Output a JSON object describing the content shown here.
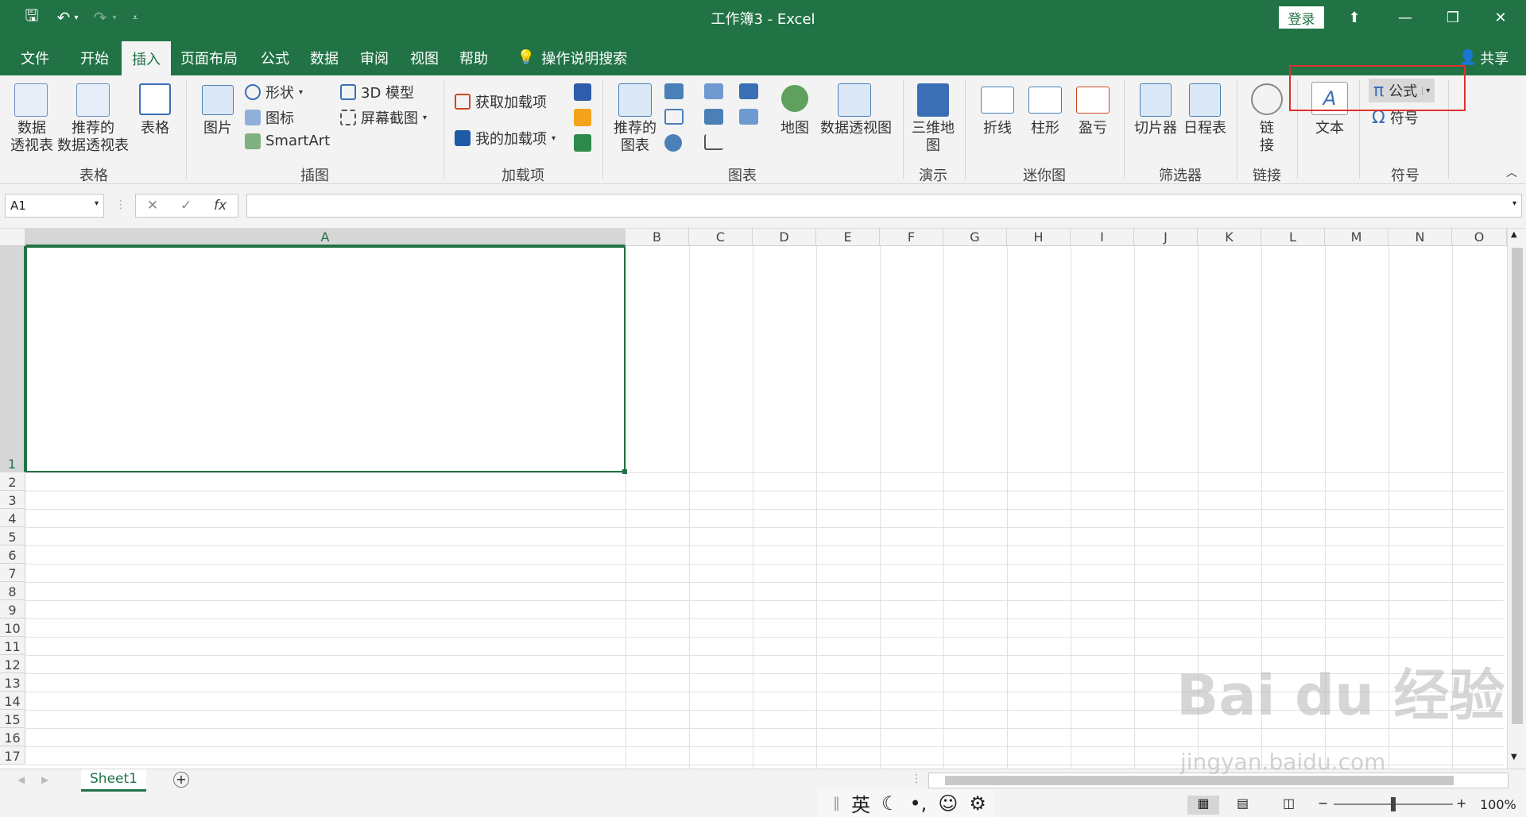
{
  "window": {
    "title": "工作簿3  -  Excel",
    "login": "登录",
    "share": "共享"
  },
  "tabs": [
    {
      "label": "文件"
    },
    {
      "label": "开始"
    },
    {
      "label": "插入"
    },
    {
      "label": "页面布局"
    },
    {
      "label": "公式"
    },
    {
      "label": "数据"
    },
    {
      "label": "审阅"
    },
    {
      "label": "视图"
    },
    {
      "label": "帮助"
    }
  ],
  "tell_me": "操作说明搜索",
  "ribbon": {
    "pivot_table": "数据\n透视表",
    "recommended_pivot": "推荐的\n数据透视表",
    "table": "表格",
    "group_table": "表格",
    "pictures": "图片",
    "shapes": "形状",
    "icons": "图标",
    "smartart": "SmartArt",
    "model3d": "3D 模型",
    "screenshot": "屏幕截图",
    "group_illustrations": "插图",
    "get_addins": "获取加载项",
    "my_addins": "我的加载项",
    "group_addins": "加载项",
    "recommended_charts": "推荐的\n图表",
    "maps": "地图",
    "pivot_chart": "数据透视图",
    "group_charts": "图表",
    "map3d": "三维地\n图",
    "group_tours": "演示",
    "line": "折线",
    "column": "柱形",
    "winloss": "盈亏",
    "group_sparklines": "迷你图",
    "slicer": "切片器",
    "timeline": "日程表",
    "group_filters": "筛选器",
    "link": "链\n接",
    "group_links": "链接",
    "text": "文本",
    "equation": "公式",
    "symbol": "符号",
    "group_symbols": "符号"
  },
  "formula_bar": {
    "name_box": "A1",
    "fx": "fx",
    "cancel": "✕",
    "enter": "✓"
  },
  "columns": [
    "A",
    "B",
    "C",
    "D",
    "E",
    "F",
    "G",
    "H",
    "I",
    "J",
    "K",
    "L",
    "M",
    "N",
    "O"
  ],
  "rows": [
    "1",
    "2",
    "3",
    "4",
    "5",
    "6",
    "7",
    "8",
    "9",
    "10",
    "11",
    "12",
    "13",
    "14",
    "15",
    "16",
    "17"
  ],
  "sheet_tab": "Sheet1",
  "ime": {
    "lang": "英"
  },
  "zoom": "100%",
  "watermark": "Bai du 经验",
  "watermark_url": "jingyan.baidu.com"
}
